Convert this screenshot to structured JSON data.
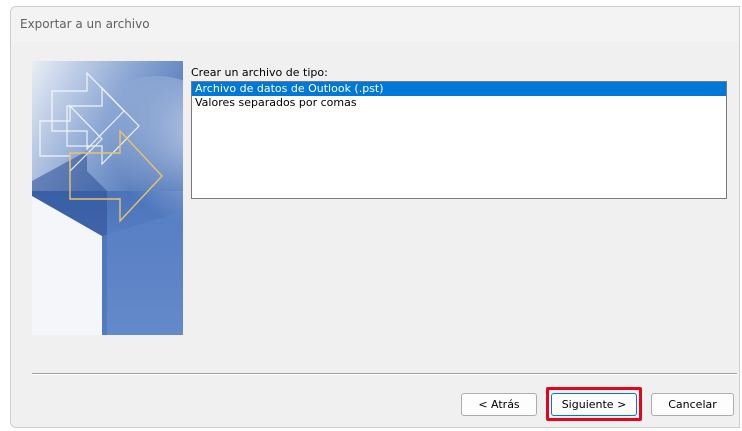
{
  "window": {
    "title": "Exportar a un archivo"
  },
  "content": {
    "list_label": "Crear un archivo de tipo:",
    "file_types": [
      "Archivo de datos de Outlook (.pst)",
      "Valores separados por comas"
    ],
    "selected_index": 0
  },
  "buttons": {
    "back_label": "< Atrás",
    "next_label": "Siguiente >",
    "cancel_label": "Cancelar"
  },
  "colors": {
    "selection": "#0078d7",
    "highlight_box": "#e3061a",
    "arrow_gold": "#e9c46a"
  }
}
